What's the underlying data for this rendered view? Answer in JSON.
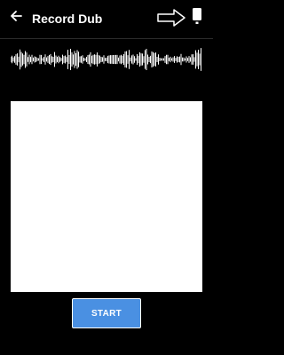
{
  "appbar": {
    "title": "Record Dub",
    "back_icon": "arrow-left-icon",
    "hint_icon": "arrow-right-outline-icon",
    "device_icon": "phone-icon"
  },
  "waveform": {
    "icon": "audio-waveform"
  },
  "preview": {
    "background": "#ffffff"
  },
  "actions": {
    "start_label": "START"
  },
  "colors": {
    "background": "#000000",
    "accent": "#4a90e2",
    "text": "#ffffff"
  }
}
